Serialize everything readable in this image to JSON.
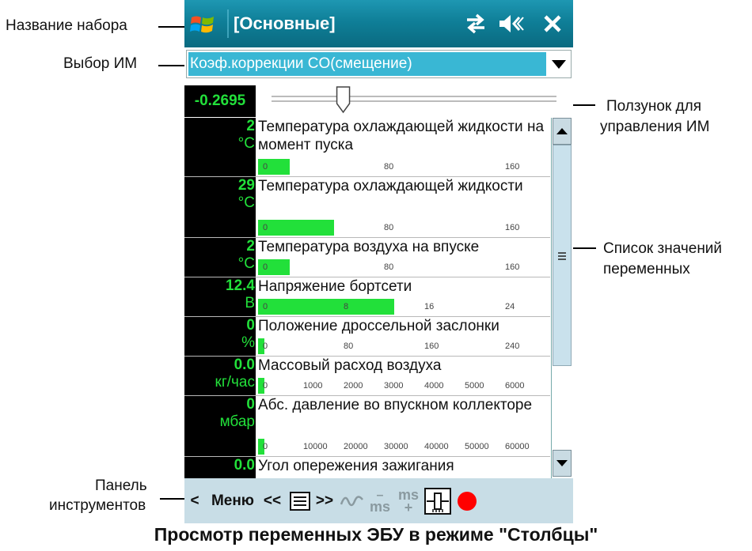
{
  "annotations": {
    "set_name": "Название набора",
    "im_select": "Выбор ИМ",
    "slider_line1": "Ползунок для",
    "slider_line2": "управления ИМ",
    "list_line1": "Список значений",
    "list_line2": "переменных",
    "toolbar_line1": "Панель",
    "toolbar_line2": "инструментов"
  },
  "window": {
    "title": "[Основные]"
  },
  "titlebar_icons": [
    "windows-logo-icon",
    "connection-icon",
    "speaker-muted-icon",
    "close-icon"
  ],
  "im": {
    "selected": "Коэф.коррекции CO(смещение)",
    "value": "-0.2695",
    "slider_level": 0.24
  },
  "variables": [
    {
      "value": "2",
      "unit": "°C",
      "name": "Температура охлаждающей жидкости на момент пуска",
      "fill": 0.12,
      "ticks": [
        "0",
        "80",
        "160"
      ]
    },
    {
      "value": "29",
      "unit": "°C",
      "name": "Температура охлаждающей жидкости",
      "fill": 0.29,
      "ticks": [
        "0",
        "80",
        "160"
      ]
    },
    {
      "value": "2",
      "unit": "°C",
      "name": "Температура воздуха на впуске",
      "fill": 0.12,
      "ticks": [
        "0",
        "80",
        "160"
      ]
    },
    {
      "value": "12.4",
      "unit": "В",
      "name": "Напряжение бортсети",
      "fill": 0.52,
      "ticks": [
        "0",
        "8",
        "16",
        "24"
      ]
    },
    {
      "value": "0",
      "unit": "%",
      "name": "Положение дроссельной заслонки",
      "fill": 0.0,
      "ticks": [
        "0",
        "80",
        "160",
        "240"
      ]
    },
    {
      "value": "0.0",
      "unit": "кг/час",
      "name": "Массовый расход воздуха",
      "fill": 0.0,
      "ticks": [
        "0",
        "1000",
        "2000",
        "3000",
        "4000",
        "5000",
        "6000"
      ]
    },
    {
      "value": "0",
      "unit": "мбар",
      "name": "Абс. давление во впускном коллекторе",
      "fill": 0.0,
      "ticks": [
        "0",
        "10000",
        "20000",
        "30000",
        "40000",
        "50000",
        "60000"
      ]
    },
    {
      "value": "0.0",
      "unit": "",
      "name": "Угол опережения зажигания",
      "fill": 0.0,
      "ticks": []
    }
  ],
  "toolbar": {
    "back": "<",
    "menu": "Меню",
    "prev": "<<",
    "next": ">>",
    "ms_minus_top": "–",
    "ms_minus_bottom": "ms",
    "ms_plus_top": "ms",
    "ms_plus_bottom": "+"
  },
  "colors": {
    "accent": "#22e03a",
    "titlebar": "#0f7f98",
    "selection": "#39b7d4",
    "record": "#ff0000"
  },
  "caption": "Просмотр переменных ЭБУ в режиме \"Столбцы\""
}
